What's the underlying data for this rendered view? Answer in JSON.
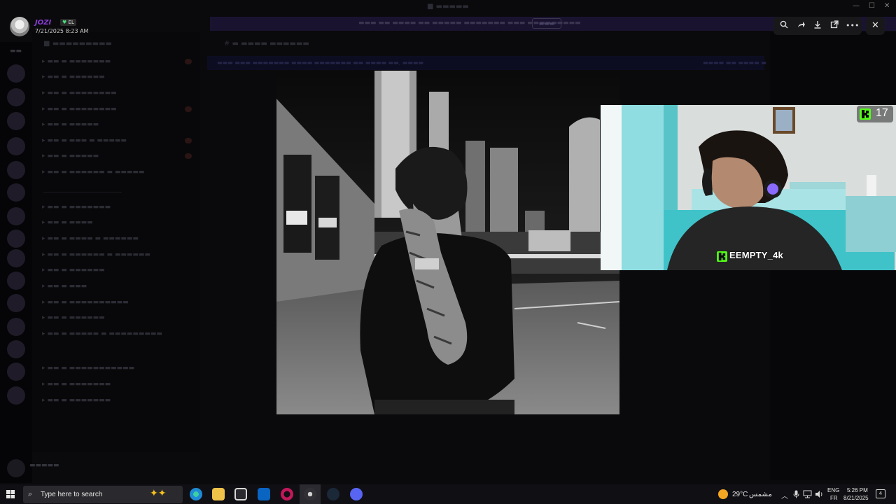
{
  "viewer": {
    "username": "JOZI",
    "tag": "EL",
    "timestamp": "7/21/2025 8:23 AM",
    "close": "✕"
  },
  "stream": {
    "viewer_count": "17",
    "streamer_name": "EEMPTY_4k",
    "accent": "#53fc18"
  },
  "taskbar": {
    "search_placeholder": "Type here to search",
    "weather_temp": "29°C",
    "weather_desc": "مشمس",
    "lang_line1": "ENG",
    "lang_line2": "FR",
    "time": "5:26 PM",
    "date": "8/21/2025",
    "notifications": "4"
  }
}
